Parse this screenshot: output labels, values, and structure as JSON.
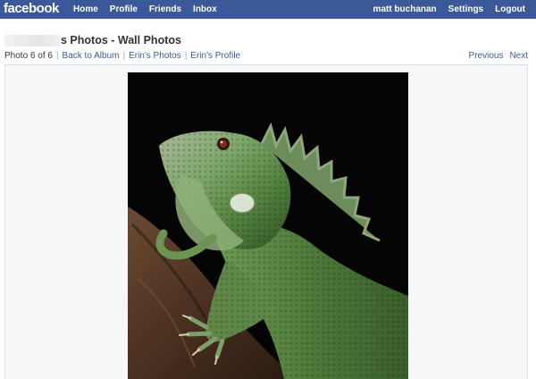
{
  "nav": {
    "logo": "facebook",
    "left_links": [
      "Home",
      "Profile",
      "Friends",
      "Inbox"
    ],
    "right_links": [
      "matt buchanan",
      "Settings",
      "Logout"
    ]
  },
  "page": {
    "title": "s Photos - Wall Photos",
    "photo_counter": "Photo 6 of 6",
    "breadcrumb_links": [
      "Back to Album",
      "Erin's Photos",
      "Erin's Profile"
    ],
    "pager": {
      "previous": "Previous",
      "next": "Next"
    }
  },
  "photo": {
    "icon": "iguana-photo"
  },
  "colors": {
    "brand_blue": "#3b5998",
    "link_blue": "#3b5998"
  }
}
